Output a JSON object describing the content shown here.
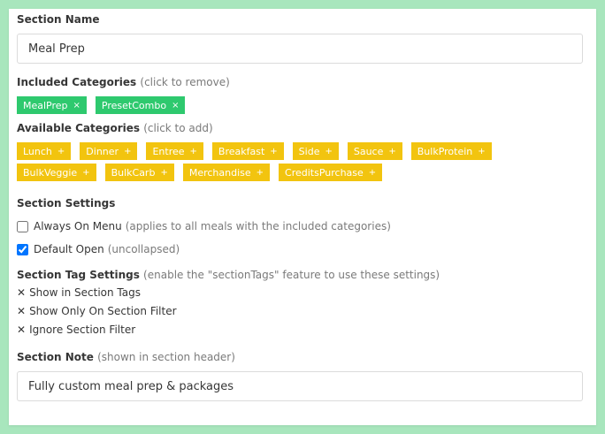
{
  "section_name": {
    "label": "Section Name",
    "value": "Meal Prep"
  },
  "included": {
    "label": "Included Categories",
    "hint": "(click to remove)",
    "remove_symbol": "×",
    "tags": [
      "MealPrep",
      "PresetCombo"
    ],
    "color": "#2ec96e"
  },
  "available": {
    "label": "Available Categories",
    "hint": "(click to add)",
    "add_symbol": "+",
    "tags": [
      "Lunch",
      "Dinner",
      "Entree",
      "Breakfast",
      "Side",
      "Sauce",
      "BulkProtein",
      "BulkVeggie",
      "BulkCarb",
      "Merchandise",
      "CreditsPurchase"
    ],
    "color": "#f2c40f"
  },
  "settings": {
    "label": "Section Settings",
    "always_on_menu": {
      "label": "Always On Menu",
      "hint": "(applies to all meals with the included categories)",
      "checked": false
    },
    "default_open": {
      "label": "Default Open",
      "hint": "(uncollapsed)",
      "checked": true
    }
  },
  "tag_settings": {
    "label": "Section Tag Settings",
    "hint": "(enable the \"sectionTags\" feature to use these settings)",
    "mark": "✕",
    "items": [
      "Show in Section Tags",
      "Show Only On Section Filter",
      "Ignore Section Filter"
    ]
  },
  "section_note": {
    "label": "Section Note",
    "hint": "(shown in section header)",
    "value": "Fully custom meal prep & packages"
  }
}
